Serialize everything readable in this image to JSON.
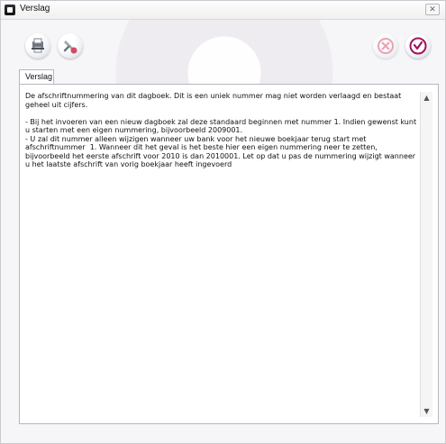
{
  "window": {
    "title": "Verslag"
  },
  "toolbar": {
    "icons": [
      "printer-icon",
      "tools-icon",
      "cancel-icon",
      "ok-icon"
    ]
  },
  "tab": {
    "label": "Verslag"
  },
  "content": {
    "text": "De afschriftnummering van dit dagboek. Dit is een uniek nummer mag niet worden verlaagd en bestaat geheel uit cijfers.\n\n- Bij het invoeren van een nieuw dagboek zal deze standaard beginnen met nummer 1. Indien gewenst kunt u starten met een eigen nummering, bijvoorbeeld 2009001.\n- U zal dit nummer alleen wijzigen wanneer uw bank voor het nieuwe boekjaar terug start met afschriftnummer  1. Wanneer dit het geval is het beste hier een eigen nummering neer te zetten, bijvoorbeeld het eerste afschrift voor 2010 is dan 2010001. Let op dat u pas de nummering wijzigt wanneer u het laatste afschrift van vorig boekjaar heeft ingevoerd"
  },
  "colors": {
    "ok": "#a0145c",
    "cancel": "#e26a84",
    "accent": "#d04b62"
  }
}
